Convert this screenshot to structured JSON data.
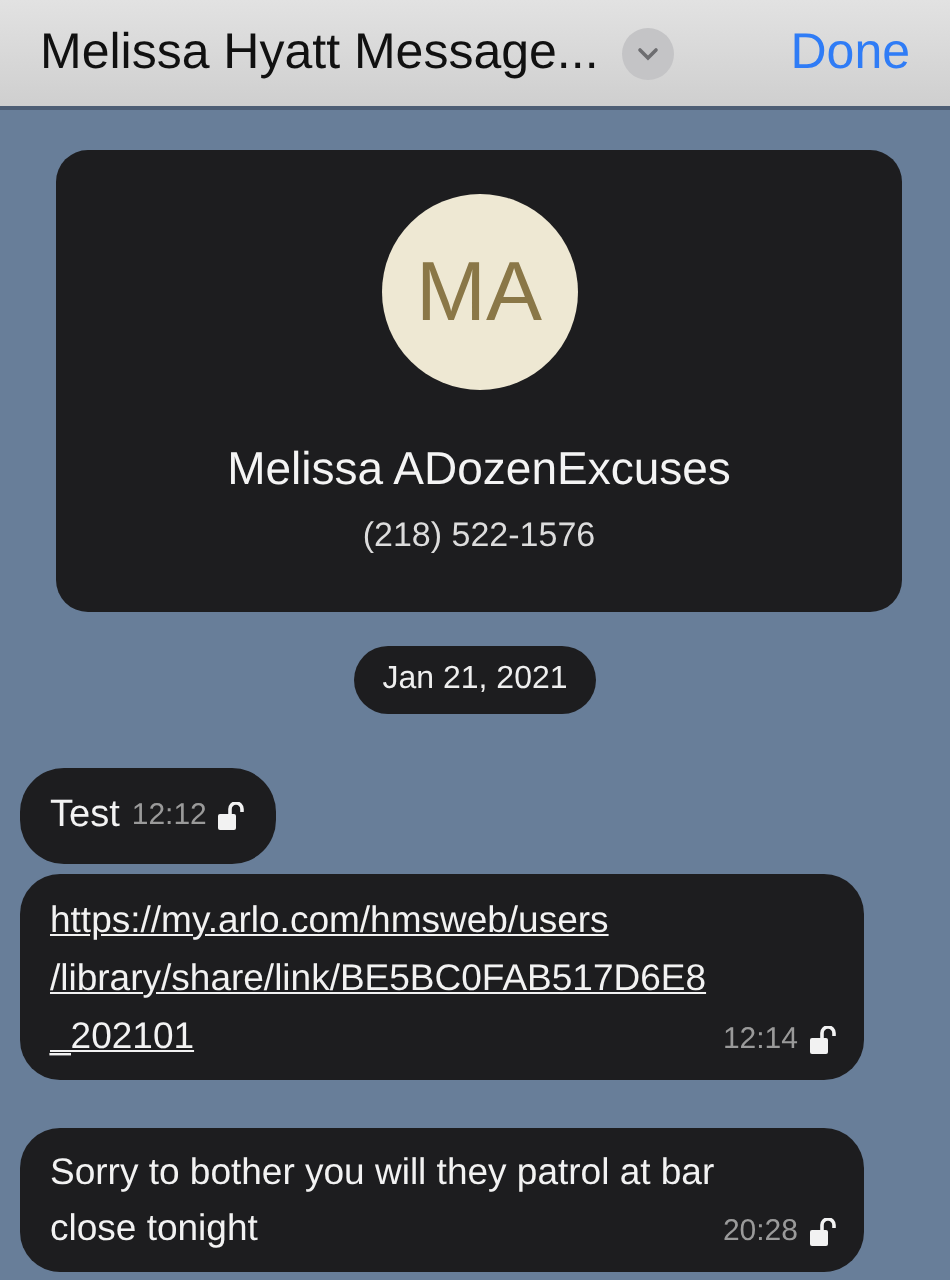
{
  "header": {
    "title": "Melissa Hyatt Message...",
    "done": "Done"
  },
  "contact": {
    "initials": "MA",
    "name": "Melissa ADozenExcuses",
    "phone": "(218) 522-1576"
  },
  "date": "Jan 21, 2021",
  "messages": [
    {
      "kind": "text",
      "lines": [
        "Test"
      ],
      "time": "12:12"
    },
    {
      "kind": "link",
      "lines": [
        "https://my.arlo.com/hmsweb/users",
        "/library/share/link/BE5BC0FAB517D6E8",
        "_202101"
      ],
      "time": "12:14"
    },
    {
      "kind": "text",
      "lines": [
        "Sorry to bother you will they patrol at bar",
        "close tonight"
      ],
      "time": "20:28"
    }
  ]
}
